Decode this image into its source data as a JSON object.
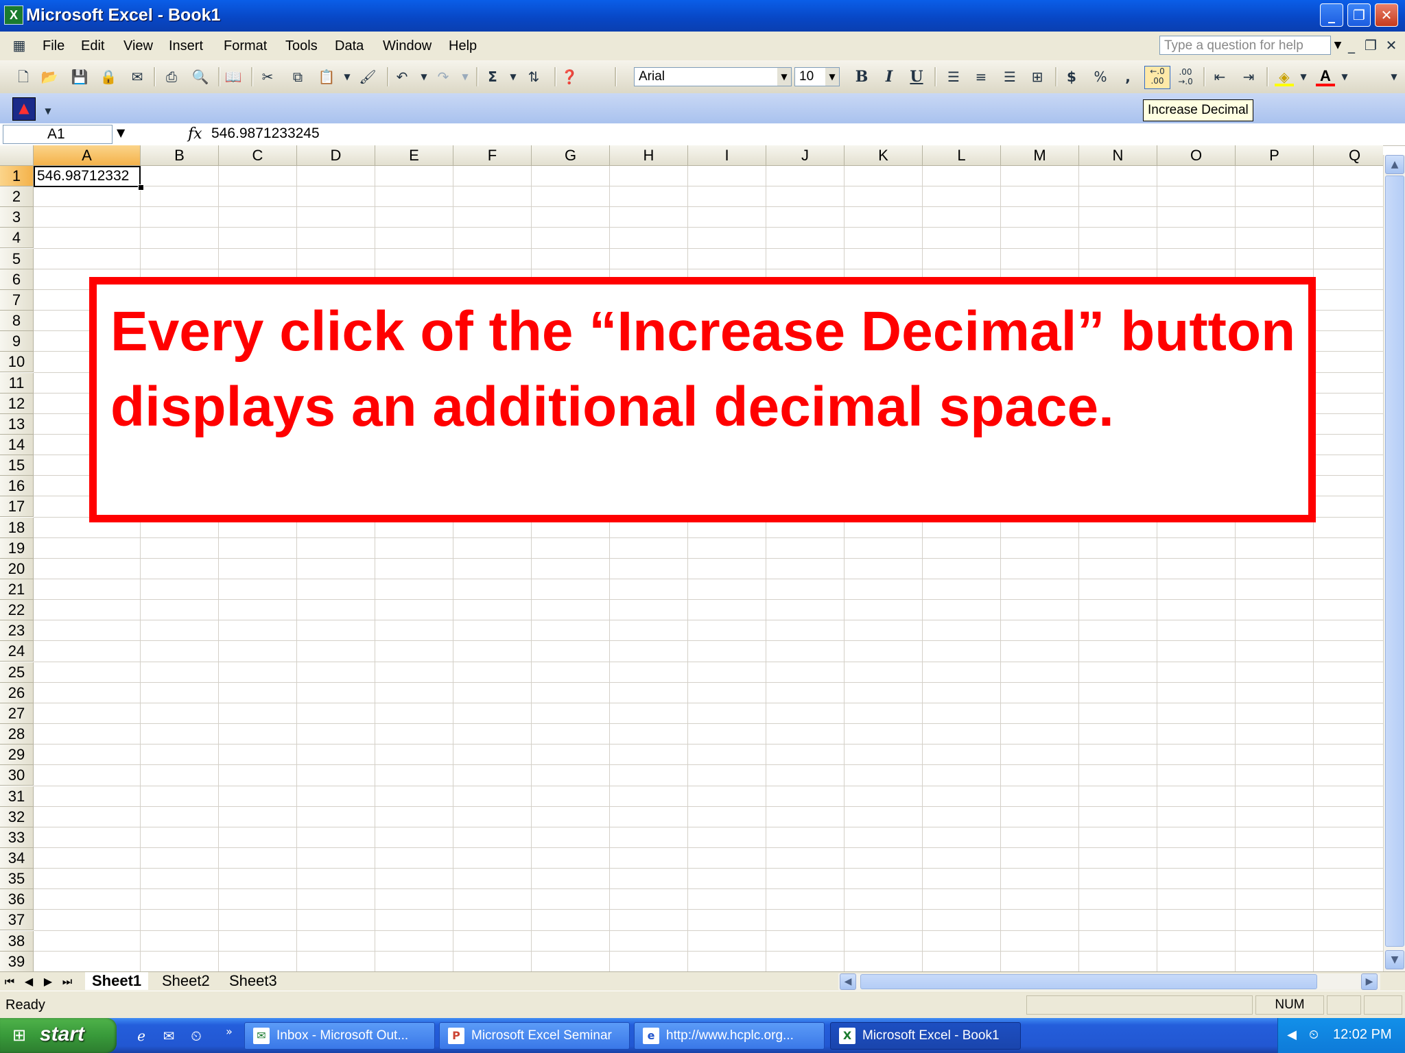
{
  "window": {
    "title": "Microsoft Excel - Book1",
    "app_icon": "excel-icon",
    "controls": {
      "minimize": "_",
      "restore": "❐",
      "close": "✕"
    }
  },
  "menu": {
    "items": [
      "File",
      "Edit",
      "View",
      "Insert",
      "Format",
      "Tools",
      "Data",
      "Window",
      "Help"
    ],
    "help_placeholder": "Type a question for help"
  },
  "toolbar": {
    "font_name": "Arial",
    "font_size": "10",
    "standard_icons": [
      "new-icon",
      "open-icon",
      "save-icon",
      "permission-icon",
      "email-icon",
      "print-icon",
      "print-preview-icon",
      "research-icon",
      "cut-icon",
      "copy-icon",
      "paste-icon",
      "format-painter-icon",
      "undo-icon",
      "redo-icon",
      "autosum-icon",
      "sort-ascending-icon",
      "help-icon"
    ],
    "format_icons": [
      "bold-icon",
      "italic-icon",
      "underline-icon",
      "align-left-icon",
      "align-center-icon",
      "align-right-icon",
      "merge-center-icon",
      "currency-icon",
      "percent-icon",
      "comma-icon",
      "increase-decimal-icon",
      "decrease-decimal-icon",
      "decrease-indent-icon",
      "increase-indent-icon",
      "fill-color-icon",
      "font-color-icon"
    ],
    "tooltip": "Increase Decimal"
  },
  "formula_bar": {
    "name_box": "A1",
    "fx_label": "fx",
    "value": "546.9871233245"
  },
  "sheet": {
    "columns": [
      "A",
      "B",
      "C",
      "D",
      "E",
      "F",
      "G",
      "H",
      "I",
      "J",
      "K",
      "L",
      "M",
      "N",
      "O",
      "P",
      "Q"
    ],
    "rows": [
      "1",
      "2",
      "3",
      "4",
      "5",
      "6",
      "7",
      "8",
      "9",
      "10",
      "11",
      "12",
      "13",
      "14",
      "15",
      "16",
      "17",
      "18",
      "19",
      "20",
      "21",
      "22",
      "23",
      "24",
      "25",
      "26",
      "27",
      "28",
      "29",
      "30",
      "31",
      "32",
      "33",
      "34",
      "35",
      "36",
      "37",
      "38",
      "39"
    ],
    "selected_cell": "A1",
    "cell_A1": "546.98712332"
  },
  "annotation": {
    "text": "Every click of the “Increase Decimal” button displays an additional decimal space.",
    "color": "#ff0000"
  },
  "tabs": {
    "sheets": [
      "Sheet1",
      "Sheet2",
      "Sheet3"
    ],
    "active": "Sheet1"
  },
  "status": {
    "ready": "Ready",
    "num": "NUM"
  },
  "taskbar": {
    "start": "start",
    "items": [
      {
        "label": "Inbox - Microsoft Out...",
        "icon": "outlook-icon"
      },
      {
        "label": "Microsoft Excel Seminar",
        "icon": "powerpoint-icon"
      },
      {
        "label": "http://www.hcplc.org...",
        "icon": "browser-icon"
      },
      {
        "label": "Microsoft Excel - Book1",
        "icon": "excel-icon"
      }
    ],
    "clock": "12:02 PM"
  }
}
